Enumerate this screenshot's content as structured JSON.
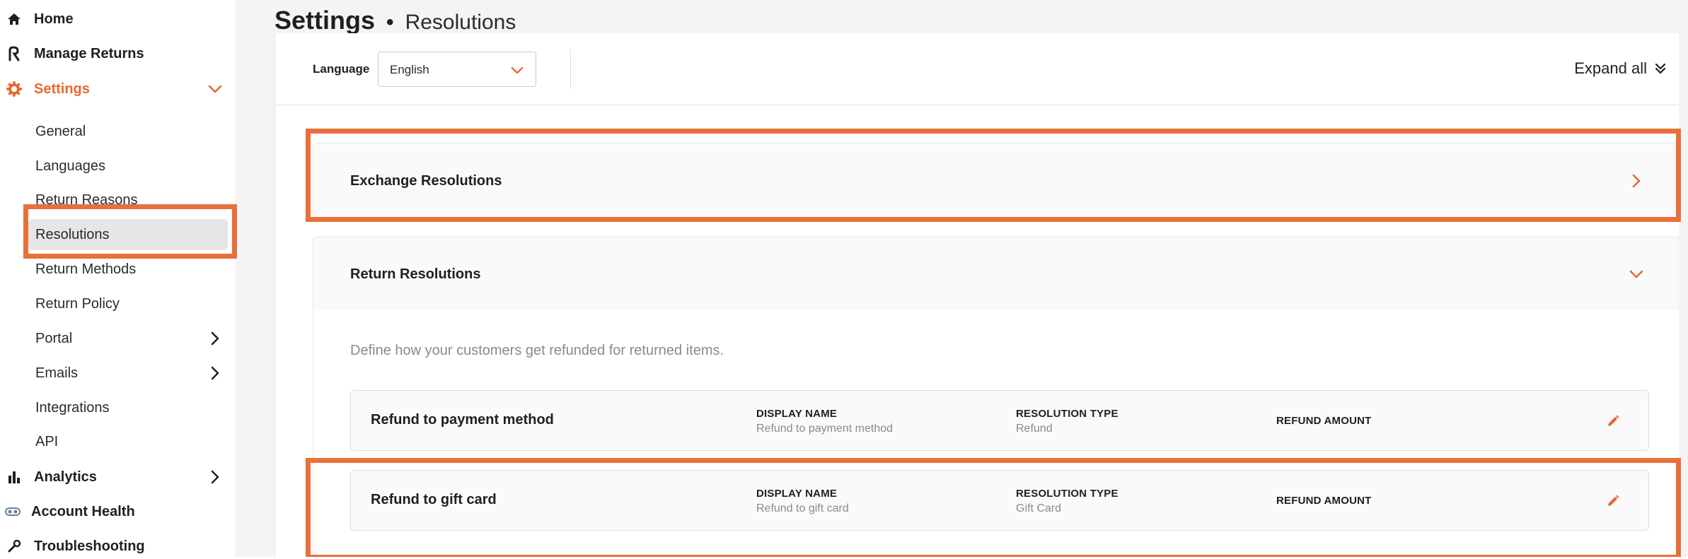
{
  "sidebar": {
    "home": "Home",
    "manage_returns": "Manage Returns",
    "settings": "Settings",
    "settings_items": [
      "General",
      "Languages",
      "Return Reasons",
      "Resolutions",
      "Return Methods",
      "Return Policy",
      "Portal",
      "Emails",
      "Integrations",
      "API"
    ],
    "analytics": "Analytics",
    "account_health": "Account Health",
    "troubleshooting": "Troubleshooting"
  },
  "header": {
    "title": "Settings",
    "separator": "•",
    "subtitle": "Resolutions"
  },
  "toolbar": {
    "language_label": "Language",
    "language_value": "English",
    "expand_all": "Expand all"
  },
  "exchange": {
    "title": "Exchange Resolutions"
  },
  "return_resolutions": {
    "title": "Return Resolutions",
    "description": "Define how your customers get refunded for returned items.",
    "rows": [
      {
        "name": "Refund to payment method",
        "display_name_label": "DISPLAY NAME",
        "display_name": "Refund to payment method",
        "type_label": "RESOLUTION TYPE",
        "type": "Refund",
        "amount_label": "REFUND AMOUNT"
      },
      {
        "name": "Refund to gift card",
        "display_name_label": "DISPLAY NAME",
        "display_name": "Refund to gift card",
        "type_label": "RESOLUTION TYPE",
        "type": "Gift Card",
        "amount_label": "REFUND AMOUNT"
      }
    ]
  },
  "colors": {
    "accent": "#e8672e",
    "highlight": "#e8703a"
  }
}
